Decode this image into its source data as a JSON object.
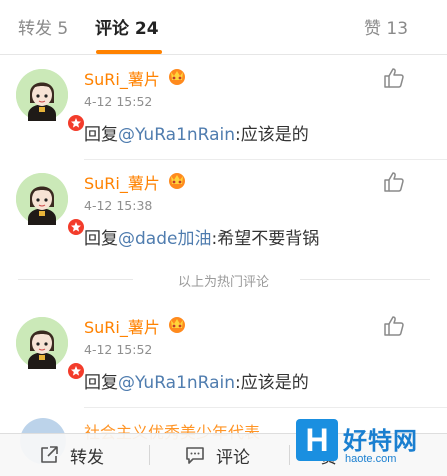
{
  "tabs": {
    "reposts": "转发 5",
    "comments": "评论 24",
    "likes": "赞 13"
  },
  "comments": [
    {
      "username": "SuRi_薯片",
      "timestamp": "4-12 15:52",
      "reply_prefix": "回复",
      "mention": "@YuRa1nRain",
      "text": ":应该是的"
    },
    {
      "username": "SuRi_薯片",
      "timestamp": "4-12 15:38",
      "reply_prefix": "回复",
      "mention": "@dade加油",
      "text": ":希望不要背锅"
    },
    {
      "username": "SuRi_薯片",
      "timestamp": "4-12 15:52",
      "reply_prefix": "回复",
      "mention": "@YuRa1nRain",
      "text": ":应该是的"
    }
  ],
  "hot_separator": "以上为热门评论",
  "partial_comment": {
    "username": "社会主义优秀美少年代表"
  },
  "bottom_bar": {
    "repost": "转发",
    "comment": "评论",
    "like": "赞"
  },
  "watermark": {
    "logo": "H",
    "text": "好特网",
    "url": "haote.com"
  },
  "colors": {
    "accent": "#ff8200",
    "mention": "#507daf",
    "badge": "#f33c2b"
  }
}
